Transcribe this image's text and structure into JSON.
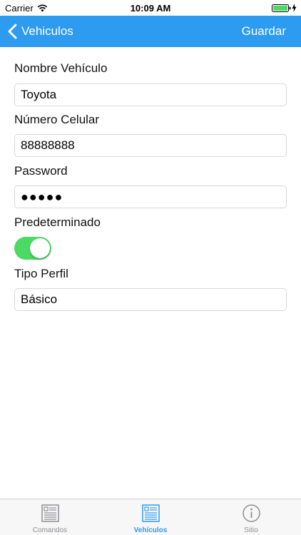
{
  "status_bar": {
    "carrier": "Carrier",
    "time": "10:09 AM"
  },
  "nav": {
    "back_label": "Vehiculos",
    "save_label": "Guardar",
    "color": "#2d9bf0"
  },
  "form": {
    "vehicle_name": {
      "label": "Nombre Vehículo",
      "value": "Toyota"
    },
    "phone": {
      "label": "Número Celular",
      "value": "88888888"
    },
    "password": {
      "label": "Password",
      "value": "●●●●●"
    },
    "default": {
      "label": "Predeterminado",
      "on": true
    },
    "profile_type": {
      "label": "Tipo Perfil",
      "value": "Básico"
    }
  },
  "tabs": [
    {
      "label": "Comandos",
      "icon": "document-icon",
      "active": false
    },
    {
      "label": "Vehículos",
      "icon": "document-icon",
      "active": true
    },
    {
      "label": "Sitio",
      "icon": "info-icon",
      "active": false
    }
  ]
}
